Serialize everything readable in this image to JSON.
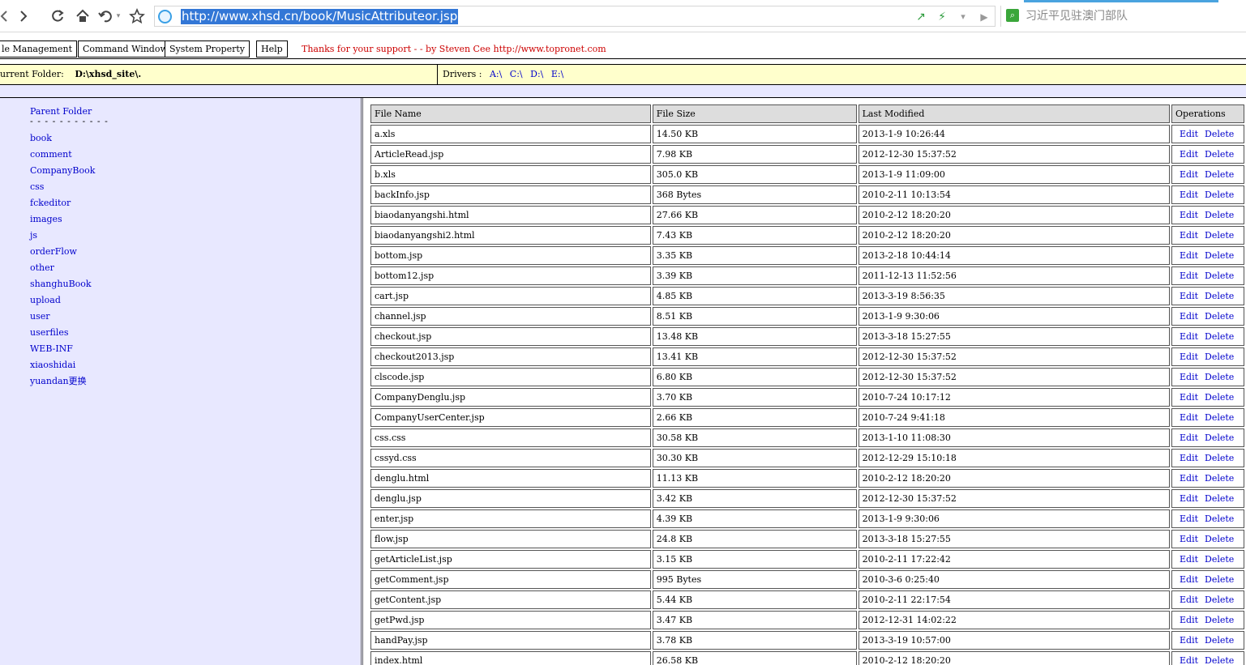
{
  "browser": {
    "url": "http://www.xhsd.cn/book/MusicAttributeor.jsp",
    "search_placeholder": "习近平见驻澳门部队"
  },
  "menu": {
    "items": [
      "le Management",
      "Command Window",
      "System Property",
      "Help"
    ],
    "thanks": "Thanks for your support - - by Steven Cee http://www.topronet.com"
  },
  "folder_bar": {
    "label": "urrent Folder:",
    "path": "D:\\xhsd_site\\.",
    "drivers_label": "Drivers :",
    "drivers": [
      "A:\\",
      "C:\\",
      "D:\\",
      "E:\\"
    ]
  },
  "tree": {
    "parent": "Parent Folder",
    "dashes": "- - - - - - - - - - -",
    "folders": [
      "book",
      "comment",
      "CompanyBook",
      "css",
      "fckeditor",
      "images",
      "js",
      "orderFlow",
      "other",
      "shanghuBook",
      "upload",
      "user",
      "userfiles",
      "WEB-INF",
      "xiaoshidai",
      "yuandan更换"
    ]
  },
  "table": {
    "headers": [
      "File Name",
      "File Size",
      "Last Modified",
      "Operations"
    ],
    "edit_label": "Edit",
    "delete_label": "Delete",
    "rows": [
      [
        "a.xls",
        "14.50 KB",
        "2013-1-9 10:26:44"
      ],
      [
        "ArticleRead.jsp",
        "7.98 KB",
        "2012-12-30 15:37:52"
      ],
      [
        "b.xls",
        "305.0 KB",
        "2013-1-9 11:09:00"
      ],
      [
        "backInfo.jsp",
        "368 Bytes",
        "2010-2-11 10:13:54"
      ],
      [
        "biaodanyangshi.html",
        "27.66 KB",
        "2010-2-12 18:20:20"
      ],
      [
        "biaodanyangshi2.html",
        "7.43 KB",
        "2010-2-12 18:20:20"
      ],
      [
        "bottom.jsp",
        "3.35 KB",
        "2013-2-18 10:44:14"
      ],
      [
        "bottom12.jsp",
        "3.39 KB",
        "2011-12-13 11:52:56"
      ],
      [
        "cart.jsp",
        "4.85 KB",
        "2013-3-19 8:56:35"
      ],
      [
        "channel.jsp",
        "8.51 KB",
        "2013-1-9 9:30:06"
      ],
      [
        "checkout.jsp",
        "13.48 KB",
        "2013-3-18 15:27:55"
      ],
      [
        "checkout2013.jsp",
        "13.41 KB",
        "2012-12-30 15:37:52"
      ],
      [
        "clscode.jsp",
        "6.80 KB",
        "2012-12-30 15:37:52"
      ],
      [
        "CompanyDenglu.jsp",
        "3.70 KB",
        "2010-7-24 10:17:12"
      ],
      [
        "CompanyUserCenter.jsp",
        "2.66 KB",
        "2010-7-24 9:41:18"
      ],
      [
        "css.css",
        "30.58 KB",
        "2013-1-10 11:08:30"
      ],
      [
        "cssyd.css",
        "30.30 KB",
        "2012-12-29 15:10:18"
      ],
      [
        "denglu.html",
        "11.13 KB",
        "2010-2-12 18:20:20"
      ],
      [
        "denglu.jsp",
        "3.42 KB",
        "2012-12-30 15:37:52"
      ],
      [
        "enter.jsp",
        "4.39 KB",
        "2013-1-9 9:30:06"
      ],
      [
        "flow.jsp",
        "24.8 KB",
        "2013-3-18 15:27:55"
      ],
      [
        "getArticleList.jsp",
        "3.15 KB",
        "2010-2-11 17:22:42"
      ],
      [
        "getComment.jsp",
        "995 Bytes",
        "2010-3-6 0:25:40"
      ],
      [
        "getContent.jsp",
        "5.44 KB",
        "2010-2-11 22:17:54"
      ],
      [
        "getPwd.jsp",
        "3.47 KB",
        "2012-12-31 14:02:22"
      ],
      [
        "handPay.jsp",
        "3.78 KB",
        "2013-3-19 10:57:00"
      ],
      [
        "index.html",
        "26.58 KB",
        "2010-2-12 18:20:20"
      ]
    ]
  }
}
